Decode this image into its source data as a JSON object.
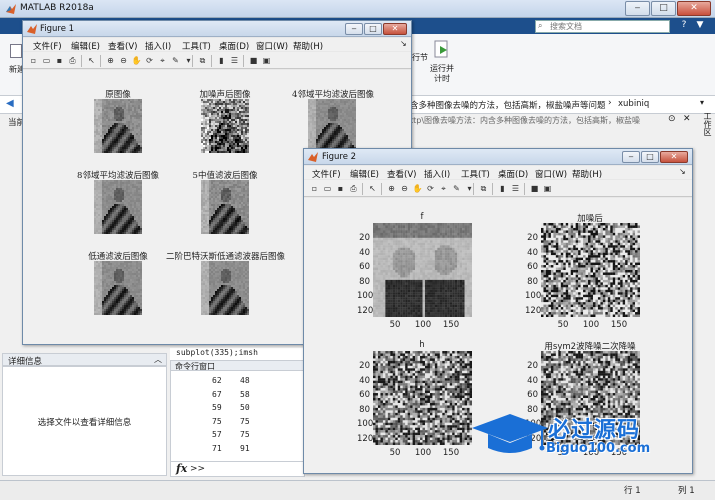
{
  "matlab": {
    "title": "MATLAB R2018a",
    "search_placeholder": "搜索文档",
    "help_icon": "?",
    "info_icon": "▼",
    "new_label": "新建",
    "step_label": "行节",
    "run_advance_label": "运行并\n计时",
    "path_text": "含多种图像去噪的方法，包括高斯，椒盐噪声等问题",
    "path_user": "xubiniq",
    "current_folder_label": "当前",
    "editor_tab": "ttp\\图像去噪方法：内含多种图像去噪的方法，包括高斯，椒盐噪",
    "workspace_label": "工作区",
    "details_label": "详细信息",
    "details_message": "选择文件以查看详细信息",
    "code_line": "subplot(335);imsh",
    "cmd_window_label": "命令行窗口",
    "cmd_rows": [
      [
        "62",
        "48"
      ],
      [
        "67",
        "58"
      ],
      [
        "59",
        "50"
      ],
      [
        "75",
        "75"
      ],
      [
        "57",
        "75"
      ],
      [
        "71",
        "91"
      ]
    ],
    "cmd_prompt": ">>",
    "status_row": "行 1",
    "status_col": "列 1"
  },
  "figure1": {
    "title": "Figure 1",
    "menu": [
      "文件(F)",
      "编辑(E)",
      "查看(V)",
      "插入(I)",
      "工具(T)",
      "桌面(D)",
      "窗口(W)",
      "帮助(H)"
    ],
    "panels": [
      {
        "title": "原图像"
      },
      {
        "title": "加噪声后图像"
      },
      {
        "title": "4邻域平均滤波后图像"
      },
      {
        "title": "8邻域平均滤波后图像"
      },
      {
        "title": "5中值滤波后图像"
      },
      {
        "title": "低通滤波后图像"
      },
      {
        "title": "二阶巴特沃斯低通滤波器后图像"
      }
    ]
  },
  "figure2": {
    "title": "Figure 2",
    "menu": [
      "文件(F)",
      "编辑(E)",
      "查看(V)",
      "插入(I)",
      "工具(T)",
      "桌面(D)",
      "窗口(W)",
      "帮助(H)"
    ],
    "axes": [
      {
        "title": "f"
      },
      {
        "title": "加噪后"
      },
      {
        "title": "h"
      },
      {
        "title": "用sym2波降噪二次降噪"
      }
    ],
    "y_ticks": [
      "20",
      "40",
      "60",
      "80",
      "100",
      "120"
    ],
    "x_ticks": [
      "50",
      "100",
      "150"
    ]
  },
  "watermark": {
    "title": "必过源码",
    "url": "Biguo100.com"
  },
  "colors": {
    "ribbon_blue": "#1d4f8c",
    "desktop_blue": "#5d8fc8",
    "watermark_blue": "#1a6fd6"
  }
}
